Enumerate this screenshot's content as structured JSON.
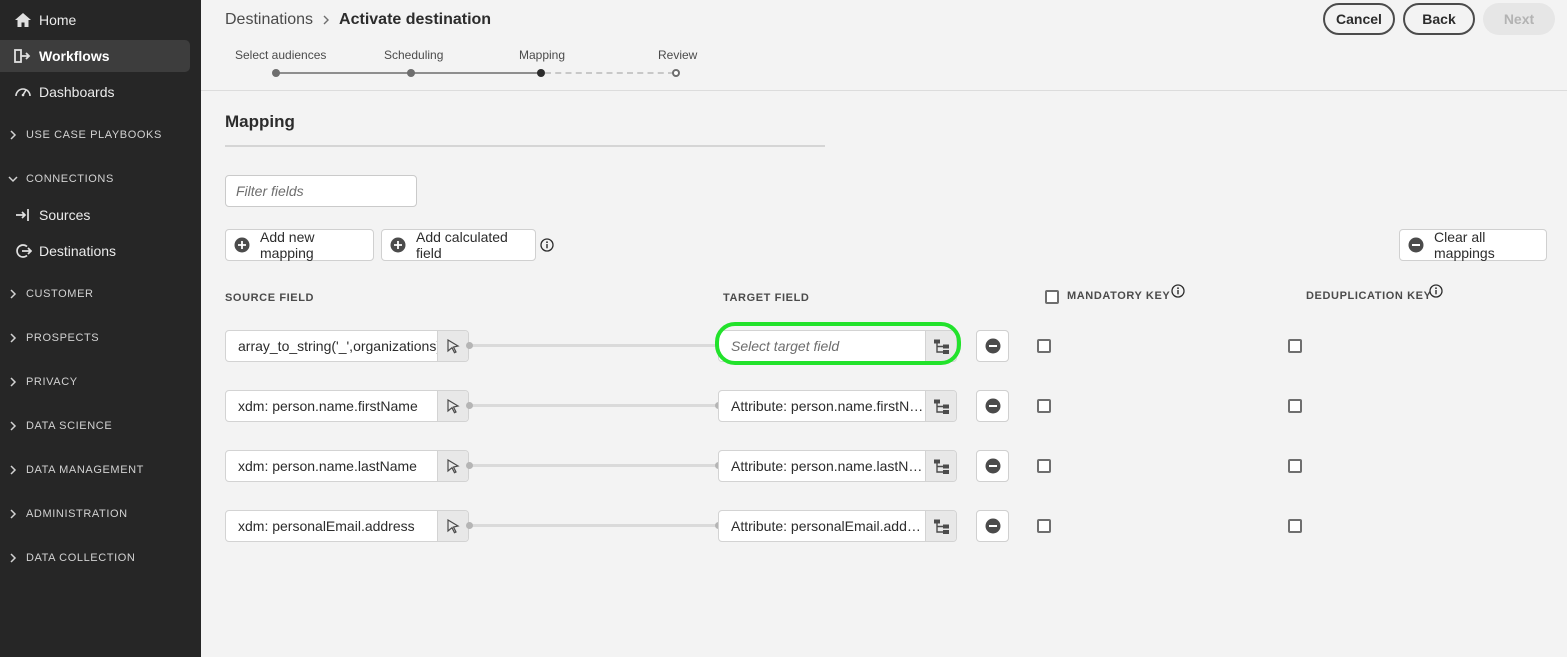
{
  "sidebar": {
    "items": [
      {
        "label": "Home",
        "icon": "home-icon"
      },
      {
        "label": "Workflows",
        "icon": "workflow-icon",
        "active": true
      },
      {
        "label": "Dashboards",
        "icon": "dashboard-gauge-icon"
      }
    ],
    "sections": [
      {
        "label": "USE CASE PLAYBOOKS",
        "expanded": false
      },
      {
        "label": "CONNECTIONS",
        "expanded": true
      },
      {
        "label": "CUSTOMER",
        "expanded": false
      },
      {
        "label": "PROSPECTS",
        "expanded": false
      },
      {
        "label": "PRIVACY",
        "expanded": false
      },
      {
        "label": "DATA SCIENCE",
        "expanded": false
      },
      {
        "label": "DATA MANAGEMENT",
        "expanded": false
      },
      {
        "label": "ADMINISTRATION",
        "expanded": false
      },
      {
        "label": "DATA COLLECTION",
        "expanded": false
      }
    ],
    "connections_items": [
      {
        "label": "Sources",
        "icon": "sources-icon"
      },
      {
        "label": "Destinations",
        "icon": "destinations-icon"
      }
    ]
  },
  "header": {
    "breadcrumb_parent": "Destinations",
    "breadcrumb_current": "Activate destination",
    "cancel_label": "Cancel",
    "back_label": "Back",
    "next_label": "Next"
  },
  "stepper": {
    "steps": [
      "Select audiences",
      "Scheduling",
      "Mapping",
      "Review"
    ],
    "current_index": 2
  },
  "mapping": {
    "title": "Mapping",
    "filter_placeholder": "Filter fields",
    "add_mapping_label": "Add new mapping",
    "add_calculated_label": "Add calculated field",
    "clear_all_label": "Clear all mappings",
    "columns": {
      "source": "SOURCE FIELD",
      "target": "TARGET FIELD",
      "mandatory": "MANDATORY KEY",
      "dedup": "DEDUPLICATION KEY"
    },
    "rows": [
      {
        "source": "array_to_string('_',organizations)",
        "target": "",
        "target_placeholder": "Select target field"
      },
      {
        "source": "xdm: person.name.firstName",
        "target": "Attribute: person.name.firstName"
      },
      {
        "source": "xdm: person.name.lastName",
        "target": "Attribute: person.name.lastName"
      },
      {
        "source": "xdm: personalEmail.address",
        "target": "Attribute: personalEmail.address"
      }
    ]
  },
  "colors": {
    "sidebar_bg": "#262626",
    "highlight": "#22e22b",
    "page_bg": "#f3f3f3"
  }
}
